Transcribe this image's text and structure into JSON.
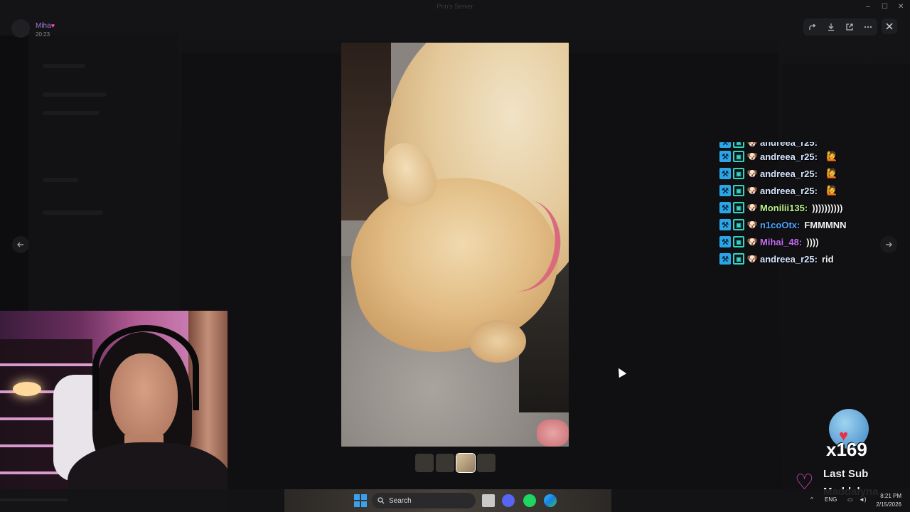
{
  "window": {
    "title": "Prin's Server",
    "controls": {
      "minimize": "–",
      "maximize": "☐",
      "close": "✕"
    }
  },
  "user_corner": {
    "name": "Miha",
    "heart": "♥",
    "time": "20:23"
  },
  "viewer": {
    "toolbar": [
      "forward-icon",
      "download-icon",
      "open-external-icon",
      "more-icon"
    ],
    "close_icon": "close-icon",
    "prev_icon": "arrow-left-icon",
    "next_icon": "arrow-right-icon",
    "thumbnails": 4,
    "active_thumbnail": 3
  },
  "chat": {
    "partial": {
      "user": "andreea_r25:",
      "color": "#d6e6ff"
    },
    "rows": [
      {
        "user": "andreea_r25:",
        "msg": "",
        "color": "#d6e6ff",
        "emote": "🙋"
      },
      {
        "user": "andreea_r25:",
        "msg": "",
        "color": "#d6e6ff",
        "emote": "🙋"
      },
      {
        "user": "andreea_r25:",
        "msg": "",
        "color": "#d6e6ff",
        "emote": "🙋"
      },
      {
        "user": "Monilii135:",
        "msg": "))))))))))",
        "color": "#b8f28a",
        "emote": ""
      },
      {
        "user": "n1coOtx:",
        "msg": "FMMMNN",
        "color": "#4aa3ff",
        "emote": ""
      },
      {
        "user": "Mihai_48:",
        "msg": "))))",
        "color": "#c36cf0",
        "emote": ""
      },
      {
        "user": "andreea_r25:",
        "msg": "rid",
        "color": "#d6e6ff",
        "emote": ""
      }
    ]
  },
  "sub_widget": {
    "count": "x169",
    "line1": "Last Sub",
    "line2": "Maddalyna"
  },
  "taskbar": {
    "search_label": "Search",
    "lang": "ENG",
    "time": "8:21 PM",
    "date": "2/15/2026"
  },
  "colors": {
    "accent_blue": "#3aa0f0",
    "pink_heart": "#e447c6"
  }
}
